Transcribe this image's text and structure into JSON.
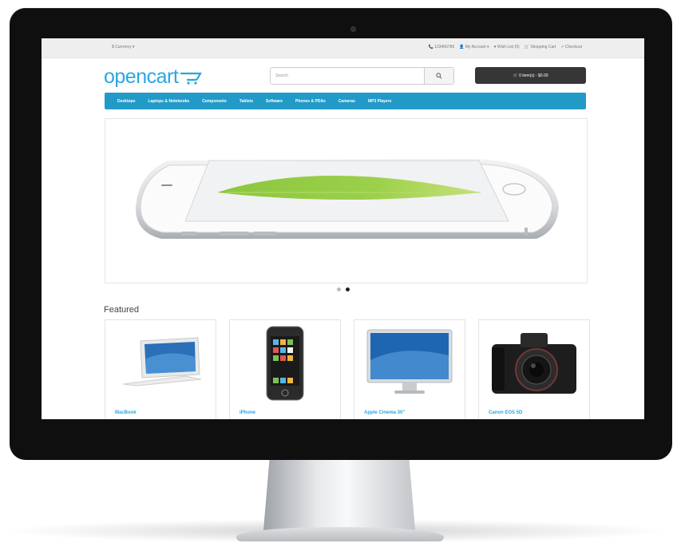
{
  "topbar": {
    "currency": "$ Currency ▾",
    "phone": "📞 123456789",
    "my_account": "👤 My Account ▾",
    "wish_list": "♥ Wish List (0)",
    "shopping_cart": "🛒 Shopping Cart",
    "checkout": "↗ Checkout"
  },
  "header": {
    "logo": "opencart",
    "search_placeholder": "Search",
    "cart_button": "🛒 0 item(s) - $0.00"
  },
  "menu": {
    "items": [
      "Desktops",
      "Laptops & Notebooks",
      "Components",
      "Tablets",
      "Software",
      "Phones & PDAs",
      "Cameras",
      "MP3 Players"
    ]
  },
  "slideshow": {
    "total_slides": 2,
    "active_slide": 2
  },
  "featured": {
    "title": "Featured",
    "products": [
      "MacBook",
      "iPhone",
      "Apple Cinema 30\"",
      "Canon EOS 5D"
    ]
  },
  "colors": {
    "accent": "#229ac8",
    "logo": "#2aa6e1",
    "cart_button": "#363636",
    "bezel": "#0f0f10"
  }
}
